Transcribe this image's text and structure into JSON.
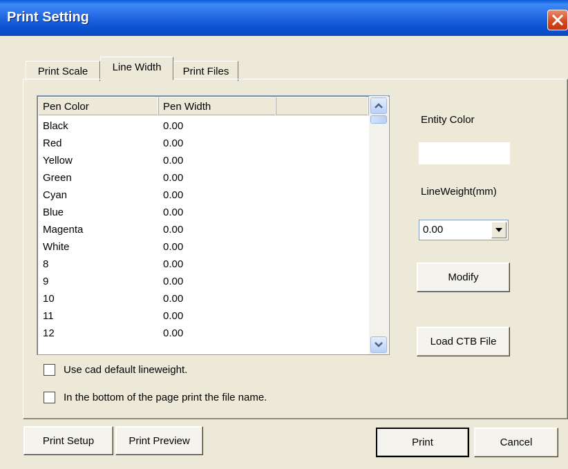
{
  "window": {
    "title": "Print Setting"
  },
  "tabs": [
    {
      "label": "Print Scale"
    },
    {
      "label": "Line Width"
    },
    {
      "label": "Print Files"
    }
  ],
  "pen_table": {
    "columns": [
      "Pen Color",
      "Pen Width"
    ],
    "rows": [
      {
        "color": "Black",
        "width": "0.00"
      },
      {
        "color": "Red",
        "width": "0.00"
      },
      {
        "color": "Yellow",
        "width": "0.00"
      },
      {
        "color": "Green",
        "width": "0.00"
      },
      {
        "color": "Cyan",
        "width": "0.00"
      },
      {
        "color": "Blue",
        "width": "0.00"
      },
      {
        "color": "Magenta",
        "width": "0.00"
      },
      {
        "color": "White",
        "width": "0.00"
      },
      {
        "color": "8",
        "width": "0.00"
      },
      {
        "color": "9",
        "width": "0.00"
      },
      {
        "color": "10",
        "width": "0.00"
      },
      {
        "color": "11",
        "width": "0.00"
      },
      {
        "color": "12",
        "width": "0.00"
      }
    ]
  },
  "checkboxes": {
    "default_lineweight": "Use cad default lineweight.",
    "print_filename": "In the bottom of the page print the file name."
  },
  "side": {
    "entity_color_label": "Entity Color",
    "lineweight_label": "LineWeight(mm)",
    "lineweight_value": "0.00",
    "modify_label": "Modify",
    "load_ctb_label": "Load CTB File"
  },
  "footer": {
    "print_setup": "Print Setup",
    "print_preview": "Print Preview",
    "print": "Print",
    "cancel": "Cancel"
  },
  "colors": {
    "title_bar": "#0a58d6",
    "dialog_bg": "#ece9d8",
    "close_button": "#d3471f"
  }
}
